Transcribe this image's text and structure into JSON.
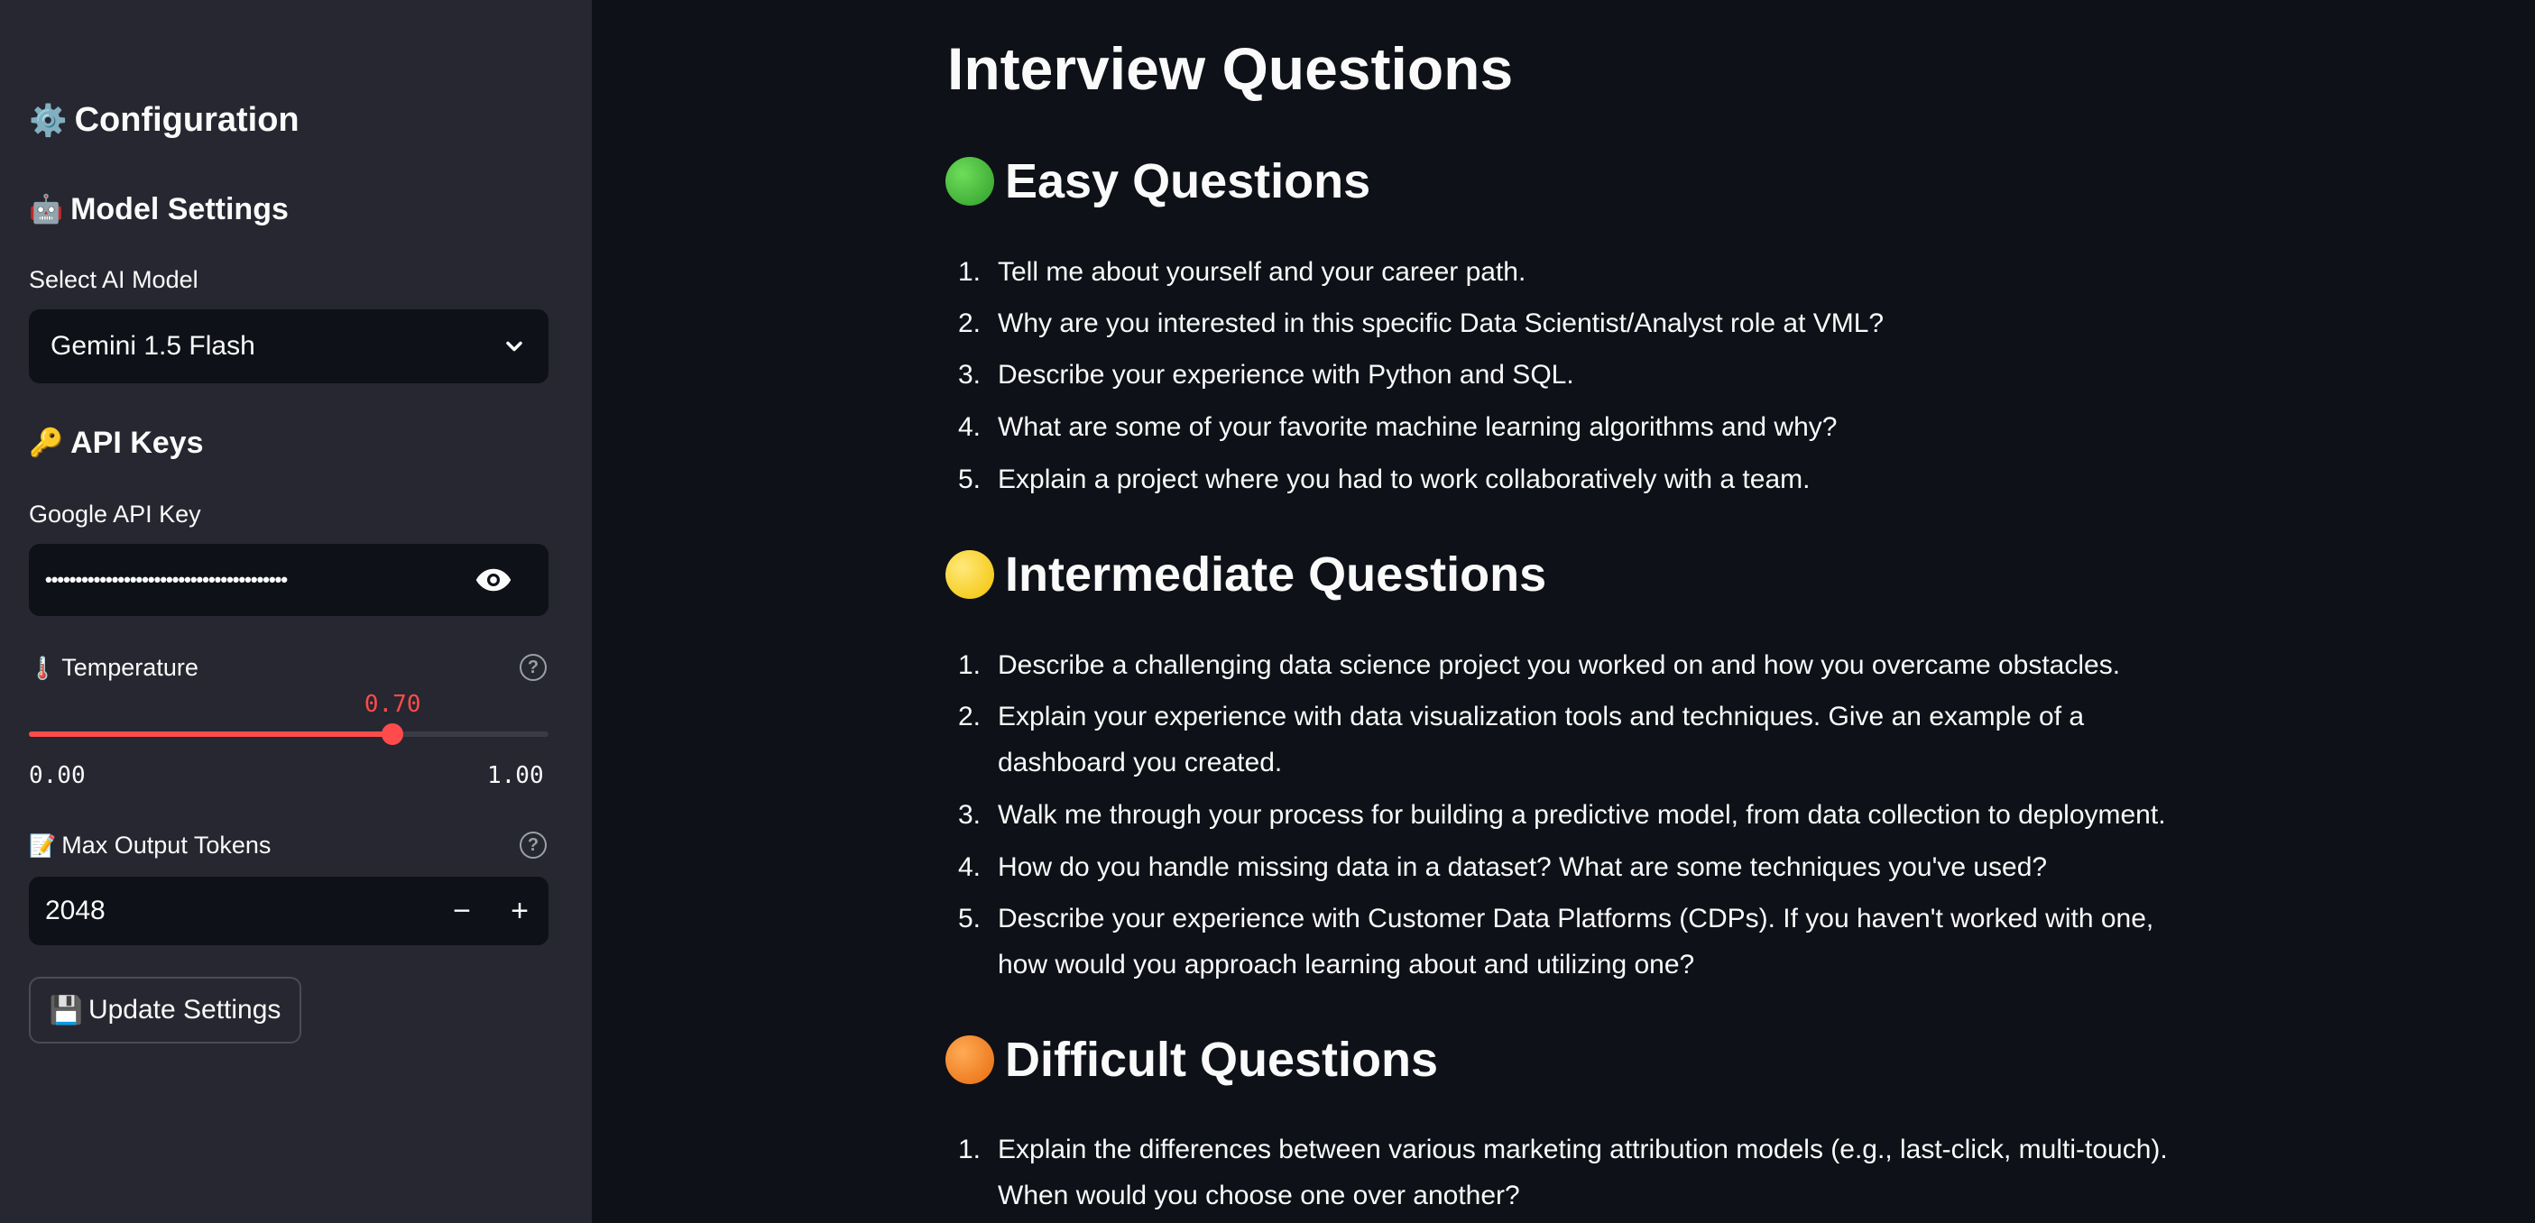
{
  "sidebar": {
    "title": "Configuration",
    "title_icon": "gear-icon",
    "model_settings": {
      "heading": "Model Settings",
      "icon": "robot-icon"
    },
    "select_model_label": "Select AI Model",
    "selected_model": "Gemini 1.5 Flash",
    "api_keys": {
      "heading": "API Keys",
      "icon": "key-icon"
    },
    "google_key_label": "Google API Key",
    "google_key_value": "••••••••••••••••••••••••••••••••••••••••",
    "temperature": {
      "label": "Temperature",
      "icon": "thermometer-icon",
      "value": "0.70",
      "value_num": 0.7,
      "min": "0.00",
      "max": "1.00"
    },
    "max_tokens": {
      "label": "Max Output Tokens",
      "icon": "memo-icon",
      "value": "2048"
    },
    "update_button": "Update Settings",
    "update_icon": "floppy-disk-icon",
    "accent_color": "#ff4b4b"
  },
  "main": {
    "title": "Interview Questions",
    "sections": [
      {
        "heading": "Easy Questions",
        "color": "green",
        "questions": [
          "Tell me about yourself and your career path.",
          "Why are you interested in this specific Data Scientist/Analyst role at VML?",
          "Describe your experience with Python and SQL.",
          "What are some of your favorite machine learning algorithms and why?",
          "Explain a project where you had to work collaboratively with a team."
        ]
      },
      {
        "heading": "Intermediate Questions",
        "color": "yellow",
        "questions": [
          "Describe a challenging data science project you worked on and how you overcame obstacles.",
          "Explain your experience with data visualization tools and techniques. Give an example of a dashboard you created.",
          "Walk me through your process for building a predictive model, from data collection to deployment.",
          "How do you handle missing data in a dataset? What are some techniques you've used?",
          "Describe your experience with Customer Data Platforms (CDPs). If you haven't worked with one, how would you approach learning about and utilizing one?"
        ]
      },
      {
        "heading": "Difficult Questions",
        "color": "orange",
        "questions": [
          "Explain the differences between various marketing attribution models (e.g., last-click, multi-touch). When would you choose one over another?"
        ]
      }
    ]
  }
}
